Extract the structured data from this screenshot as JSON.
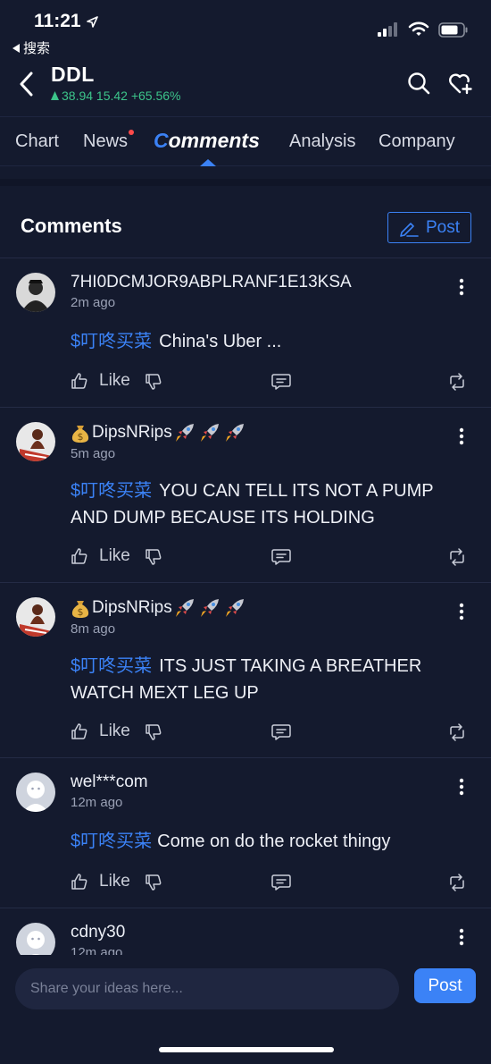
{
  "status_bar": {
    "time": "11:21",
    "back_app": "搜索",
    "icons": [
      "location-arrow-icon",
      "signal-icon",
      "wifi-icon",
      "battery-icon"
    ]
  },
  "header": {
    "ticker": "DDL",
    "quote": "38.94 15.42 +65.56%",
    "quote_color": "#3cc48a",
    "icons": [
      "back-chevron-icon",
      "search-icon",
      "heart-add-icon"
    ]
  },
  "tabs": [
    {
      "label": "Chart"
    },
    {
      "label": "News",
      "badge": true
    },
    {
      "label": "Comments",
      "active": true
    },
    {
      "label": "Analysis"
    },
    {
      "label": "Company"
    }
  ],
  "comments_section": {
    "title": "Comments",
    "post_label": "Post"
  },
  "comments": [
    {
      "username": "7HI0DCMJOR9ABPLRANF1E13KSA",
      "time": "2m ago",
      "cashtag": "$叮咚买菜",
      "text": "China's Uber ...",
      "like_label": "Like"
    },
    {
      "username": "DipsNRips",
      "username_emoji": [
        "money-bag-icon",
        "rocket-icon",
        "rocket-icon",
        "rocket-icon"
      ],
      "time": "5m ago",
      "cashtag": "$叮咚买菜",
      "text": "YOU CAN TELL ITS NOT A PUMP AND DUMP BECAUSE ITS HOLDING",
      "like_label": "Like"
    },
    {
      "username": "DipsNRips",
      "username_emoji": [
        "money-bag-icon",
        "rocket-icon",
        "rocket-icon",
        "rocket-icon"
      ],
      "time": "8m ago",
      "cashtag": "$叮咚买菜",
      "text": "ITS JUST TAKING A BREATHER WATCH MEXT LEG UP",
      "like_label": "Like"
    },
    {
      "username": "wel***com",
      "time": "12m ago",
      "cashtag": "$叮咚买菜",
      "text": "Come on do the rocket thingy",
      "like_label": "Like"
    },
    {
      "username": "cdny30",
      "time": "12m ago"
    }
  ],
  "composer": {
    "placeholder": "Share your ideas here...",
    "post_label": "Post"
  },
  "colors": {
    "background": "#141a2e",
    "accent": "#3b82f6",
    "positive": "#3cc48a"
  }
}
